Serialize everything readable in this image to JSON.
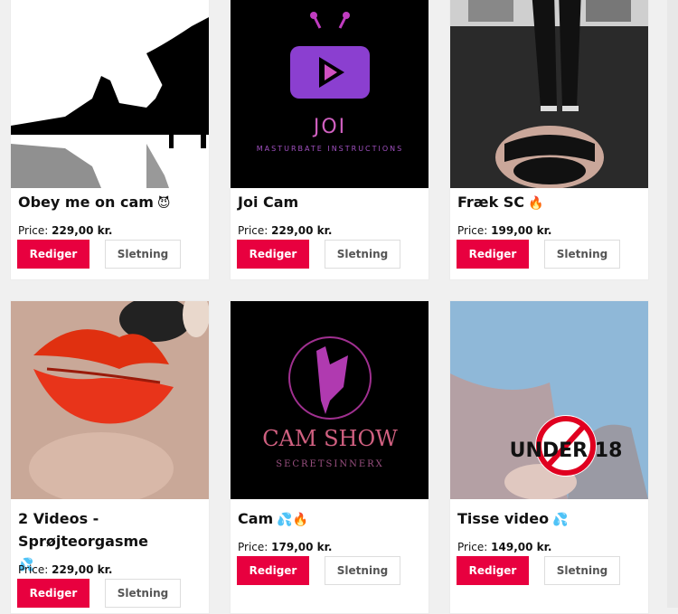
{
  "products": [
    {
      "title": "Obey me on cam",
      "emoji": "😈",
      "price_label": "Price:",
      "price": "229,00 kr.",
      "edit_label": "Rediger",
      "delete_label": "Sletning"
    },
    {
      "title": "Joi Cam",
      "emoji": "",
      "price_label": "Price:",
      "price": "229,00 kr.",
      "edit_label": "Rediger",
      "delete_label": "Sletning",
      "thumb_text": "JOI",
      "thumb_subtext": "MASTURBATE INSTRUCTIONS"
    },
    {
      "title": "Fræk SC",
      "emoji": "🔥",
      "price_label": "Price:",
      "price": "199,00 kr.",
      "edit_label": "Rediger",
      "delete_label": "Sletning"
    },
    {
      "title": "2 Videos - Sprøjteorgasme",
      "emoji": "💦",
      "price_label": "Price:",
      "price": "229,00 kr.",
      "edit_label": "Rediger",
      "delete_label": "Sletning"
    },
    {
      "title": "Cam",
      "emoji": "💦🔥",
      "price_label": "Price:",
      "price": "179,00 kr.",
      "edit_label": "Rediger",
      "delete_label": "Sletning",
      "thumb_text": "CAM SHOW",
      "thumb_subtext": "SECRETSINNERX"
    },
    {
      "title": "Tisse video",
      "emoji": "💦",
      "price_label": "Price:",
      "price": "149,00 kr.",
      "edit_label": "Rediger",
      "delete_label": "Sletning",
      "thumb_text": "UNDER 18"
    }
  ],
  "colors": {
    "accent": "#e8003f",
    "background": "#f0f0f0"
  }
}
